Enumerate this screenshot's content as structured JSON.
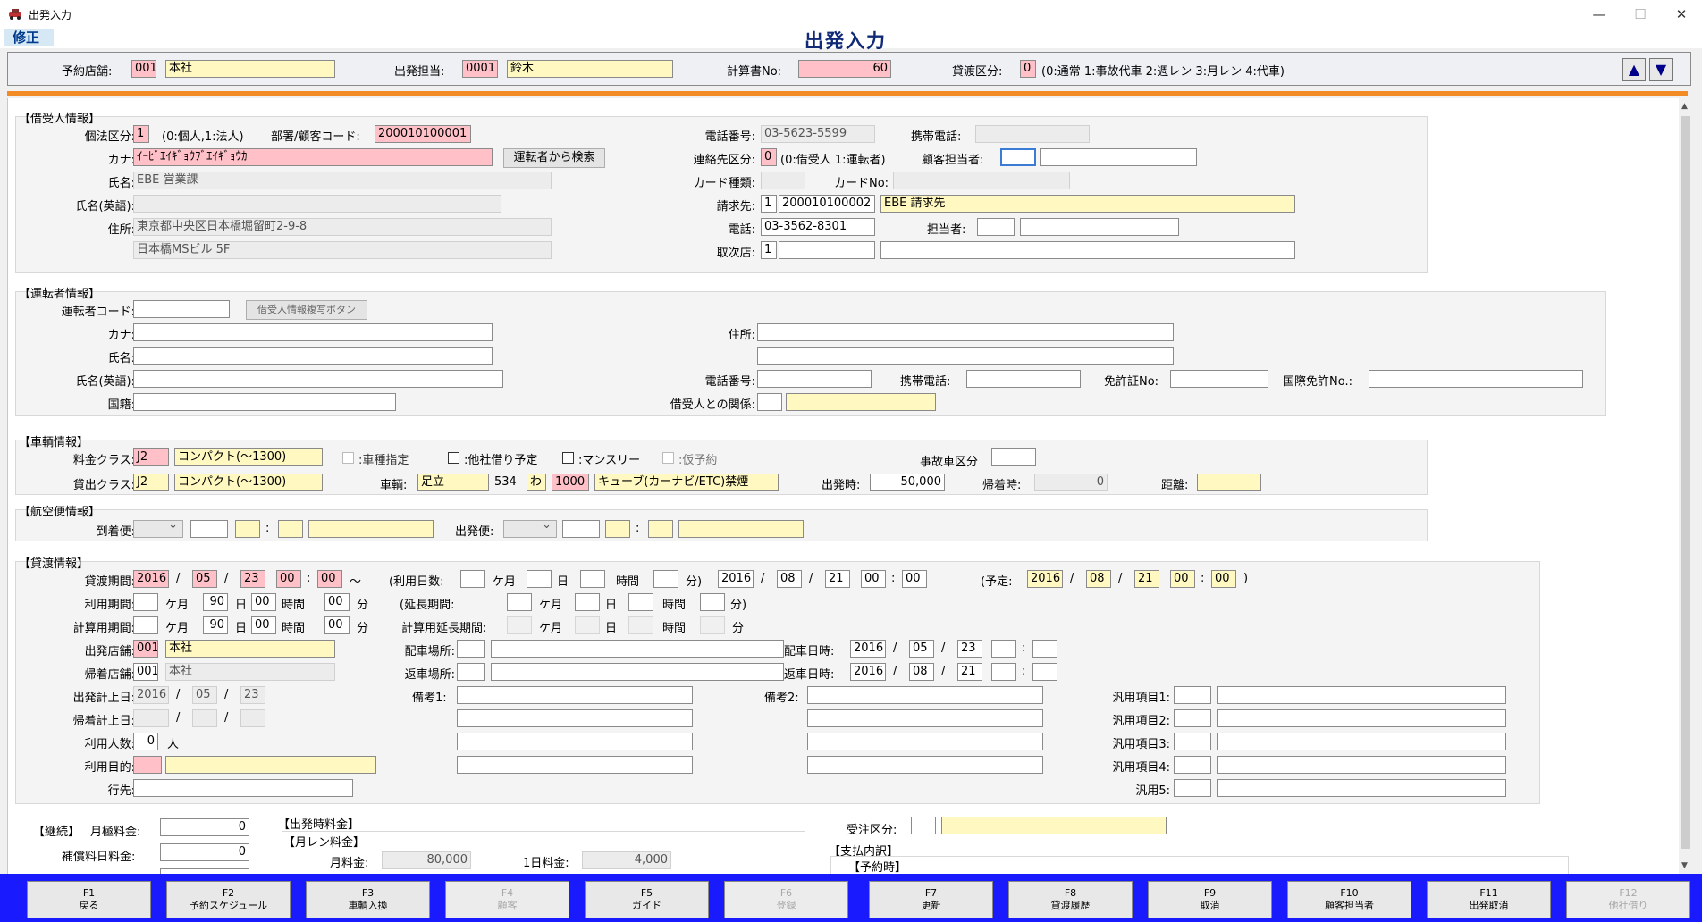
{
  "window": {
    "title": "出発入力",
    "min": "—",
    "max": "☐",
    "close": "✕"
  },
  "mode": "修正",
  "page_title": "出発入力",
  "top": {
    "store_label": "予約店舗:",
    "store_code": "001",
    "store_name": "本社",
    "staff_label": "出発担当:",
    "staff_code": "0001",
    "staff_name": "鈴木",
    "calc_label": "計算書No:",
    "calc_no": "60",
    "lend_label": "貸渡区分:",
    "lend_code": "0",
    "lend_note": "(0:通常 1:事故代車 2:週レン 3:月レン 4:代車)",
    "up": "▲",
    "down": "▼"
  },
  "borrower": {
    "section": "【借受人情報】",
    "kind_label": "個法区分:",
    "kind_value": "1",
    "kind_note": "(0:個人,1:法人)",
    "dept_label": "部署/顧客コード:",
    "dept_value": "200010100001",
    "kana_label": "カナ:",
    "kana_value": "ｲｰﾋﾞｴｲｷﾞｮｳﾌﾞｴｲｷﾞｮｳｶ",
    "search_btn": "運転者から検索",
    "name_label": "氏名:",
    "name_value": "EBE 営業課",
    "name_en_label": "氏名(英語):",
    "name_en_value": "",
    "addr_label": "住所:",
    "addr1": "東京都中央区日本橋堀留町2-9-8",
    "addr2": "日本橋MSビル 5F",
    "tel_label": "電話番号:",
    "tel_value": "03-5623-5599",
    "mobile_label": "携帯電話:",
    "mobile_value": "",
    "contact_label": "連絡先区分:",
    "contact_value": "0",
    "contact_note": "(0:借受人 1:運転者)",
    "cust_staff_label": "顧客担当者:",
    "card_type_label": "カード種類:",
    "card_no_label": "カードNo:",
    "bill_label": "請求先:",
    "bill_kind": "1",
    "bill_code": "200010100002",
    "bill_name": "EBE 請求先",
    "phone2_label": "電話:",
    "phone2_value": "03-3562-8301",
    "person_label": "担当者:",
    "agent_label": "取次店:",
    "agent_value": "1"
  },
  "driver": {
    "section": "【運転者情報】",
    "code_label": "運転者コード:",
    "copy_btn": "借受人情報複写ボタン",
    "kana_label": "カナ:",
    "name_label": "氏名:",
    "name_en_label": "氏名(英語):",
    "nation_label": "国籍:",
    "addr_label": "住所:",
    "tel_label": "電話番号:",
    "mobile_label": "携帯電話:",
    "license_label": "免許証No:",
    "intl_label": "国際免許No.:",
    "relation_label": "借受人との関係:"
  },
  "vehicle": {
    "section": "【車輌情報】",
    "rate_label": "料金クラス:",
    "rate_code": "J2",
    "rate_name": "コンパクト(～1300)",
    "lend_label": "貸出クラス:",
    "lend_code": "J2",
    "lend_name": "コンパクト(～1300)",
    "opt_type": ":車種指定",
    "opt_other": ":他社借り予定",
    "opt_monthly": ":マンスリー",
    "opt_temp": ":仮予約",
    "accident_label": "事故車区分",
    "car_label": "車輌:",
    "plate_area": "足立",
    "plate_class": "534",
    "plate_kana": "わ",
    "plate_no": "1000",
    "car_name": "キューブ(カーナビ/ETC)禁煙",
    "depart_label": "出発時:",
    "depart_km": "50,000",
    "return_label": "帰着時:",
    "return_km": "0",
    "dist_label": "距離:"
  },
  "flight": {
    "section": "【航空便情報】",
    "arrive_label": "到着便:",
    "depart_label": "出発便:",
    "colon": ":"
  },
  "lend": {
    "section": "【貸渡情報】",
    "period_label": "貸渡期間:",
    "y": "2016",
    "m": "05",
    "d": "23",
    "hh": "00",
    "mm": "00",
    "tilde": "～",
    "days_label": "(利用日数:",
    "month_u": "ケ月",
    "day_u": "日",
    "hour_u": "時間",
    "min_close": "分)",
    "ey": "2016",
    "em": "08",
    "ed": "21",
    "ehh": "00",
    "emm": "00",
    "plan_label": "(予定:",
    "py": "2016",
    "pm": "08",
    "pd": "21",
    "phh": "00",
    "pmm": "00",
    "close": ")",
    "use_label": "利用期間:",
    "ext_label": "(延長期間:",
    "calc_label": "計算用期間:",
    "calc_ext_label": "計算用延長期間:",
    "use_days": "90",
    "use_h": "00",
    "use_m": "00",
    "calc_days": "90",
    "calc_h": "00",
    "calc_m": "00",
    "month_unit": "ケ月",
    "day_unit": "日",
    "hour_unit": "時間",
    "min_unit": "分",
    "dstore_label": "出発店舗:",
    "dstore_code": "001",
    "dstore_name": "本社",
    "rstore_label": "帰着店舗:",
    "rstore_code": "001",
    "rstore_name": "本社",
    "dispatch_place": "配車場所:",
    "return_place": "返車場所:",
    "dispatch_dt": "配車日時:",
    "dy": "2016",
    "dm": "05",
    "dd": "23",
    "return_dt": "返車日時:",
    "ry": "2016",
    "rm": "08",
    "rd": "21",
    "dcalc_label": "出発計上日:",
    "cy": "2016",
    "cm": "05",
    "cd": "23",
    "rcalc_label": "帰着計上日:",
    "people_label": "利用人数:",
    "people": "0",
    "people_unit": "人",
    "purpose_label": "利用目的:",
    "dest_label": "行先:",
    "note1": "備考1:",
    "note2": "備考2:",
    "gen1": "汎用項目1:",
    "gen2": "汎用項目2:",
    "gen3": "汎用項目3:",
    "gen4": "汎用項目4:",
    "gen5": "汎用5:",
    "slash": "/",
    "colon": ":"
  },
  "bottom": {
    "cont_label": "【継続】",
    "month_fee_label": "月極料金:",
    "month_fee": "0",
    "comp_label": "補償料日料金:",
    "comp_fee": "0",
    "dep_section": "【出発時料金】",
    "monthly_section": "【月レン料金】",
    "monthly_label": "月料金:",
    "monthly_value": "80,000",
    "daily_label": "1日料金:",
    "daily_value": "4,000",
    "order_label": "受注区分:",
    "pay_section": "【支払内訳】",
    "reserve_section": "【予約時】"
  },
  "fkeys": [
    {
      "key": "F1",
      "label": "戻る",
      "enabled": true
    },
    {
      "key": "F2",
      "label": "予約スケジュール",
      "enabled": true
    },
    {
      "key": "F3",
      "label": "車輌入換",
      "enabled": true
    },
    {
      "key": "F4",
      "label": "顧客",
      "enabled": false
    },
    {
      "key": "F5",
      "label": "ガイド",
      "enabled": true
    },
    {
      "key": "F6",
      "label": "登録",
      "enabled": false
    },
    {
      "key": "F7",
      "label": "更新",
      "enabled": true
    },
    {
      "key": "F8",
      "label": "貸渡履歴",
      "enabled": true
    },
    {
      "key": "F9",
      "label": "取消",
      "enabled": true
    },
    {
      "key": "F10",
      "label": "顧客担当者",
      "enabled": true
    },
    {
      "key": "F11",
      "label": "出発取消",
      "enabled": true
    },
    {
      "key": "F12",
      "label": "他社借り",
      "enabled": false
    }
  ],
  "colors": {
    "accent_orange": "#f28a26",
    "fkey_bar": "#1a1aff",
    "title_blue": "#102a78",
    "pink": "#ffc0c8",
    "yellow": "#fff8c0"
  }
}
